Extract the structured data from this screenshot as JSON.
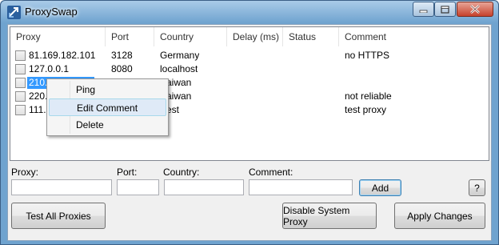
{
  "window": {
    "title": "ProxySwap"
  },
  "colors": {
    "titlebar": "#6fa3cf",
    "selection": "#3399ff",
    "menu_highlight": "#dfeaf7"
  },
  "icons": {
    "app": "proxyswap-logo-icon",
    "minimize": "minimize-icon",
    "maximize": "maximize-icon",
    "close": "close-icon"
  },
  "table": {
    "columns": [
      "Proxy",
      "Port",
      "Country",
      "Delay (ms)",
      "Status",
      "Comment"
    ],
    "rows": [
      {
        "proxy": "81.169.182.101",
        "port": "3128",
        "country": "Germany",
        "delay": "",
        "status": "",
        "comment": "no HTTPS"
      },
      {
        "proxy": "127.0.0.1",
        "port": "8080",
        "country": "localhost",
        "delay": "",
        "status": "",
        "comment": ""
      },
      {
        "proxy": "210.",
        "port": "",
        "country": "aiwan",
        "delay": "",
        "status": "",
        "comment": ""
      },
      {
        "proxy": "220.",
        "port": "",
        "country": "aiwan",
        "delay": "",
        "status": "",
        "comment": "not reliable"
      },
      {
        "proxy": "111.",
        "port": "",
        "country": "est",
        "delay": "",
        "status": "",
        "comment": "test proxy"
      }
    ]
  },
  "context_menu": {
    "items": [
      "Ping",
      "Edit Comment",
      "Delete"
    ],
    "highlighted": "Edit Comment"
  },
  "form": {
    "proxy_label": "Proxy:",
    "port_label": "Port:",
    "country_label": "Country:",
    "comment_label": "Comment:",
    "proxy_value": "",
    "port_value": "",
    "country_value": "",
    "comment_value": "",
    "add_label": "Add",
    "help_label": "?"
  },
  "buttons": {
    "test_all": "Test All Proxies",
    "disable_proxy": "Disable System Proxy",
    "apply": "Apply Changes"
  }
}
